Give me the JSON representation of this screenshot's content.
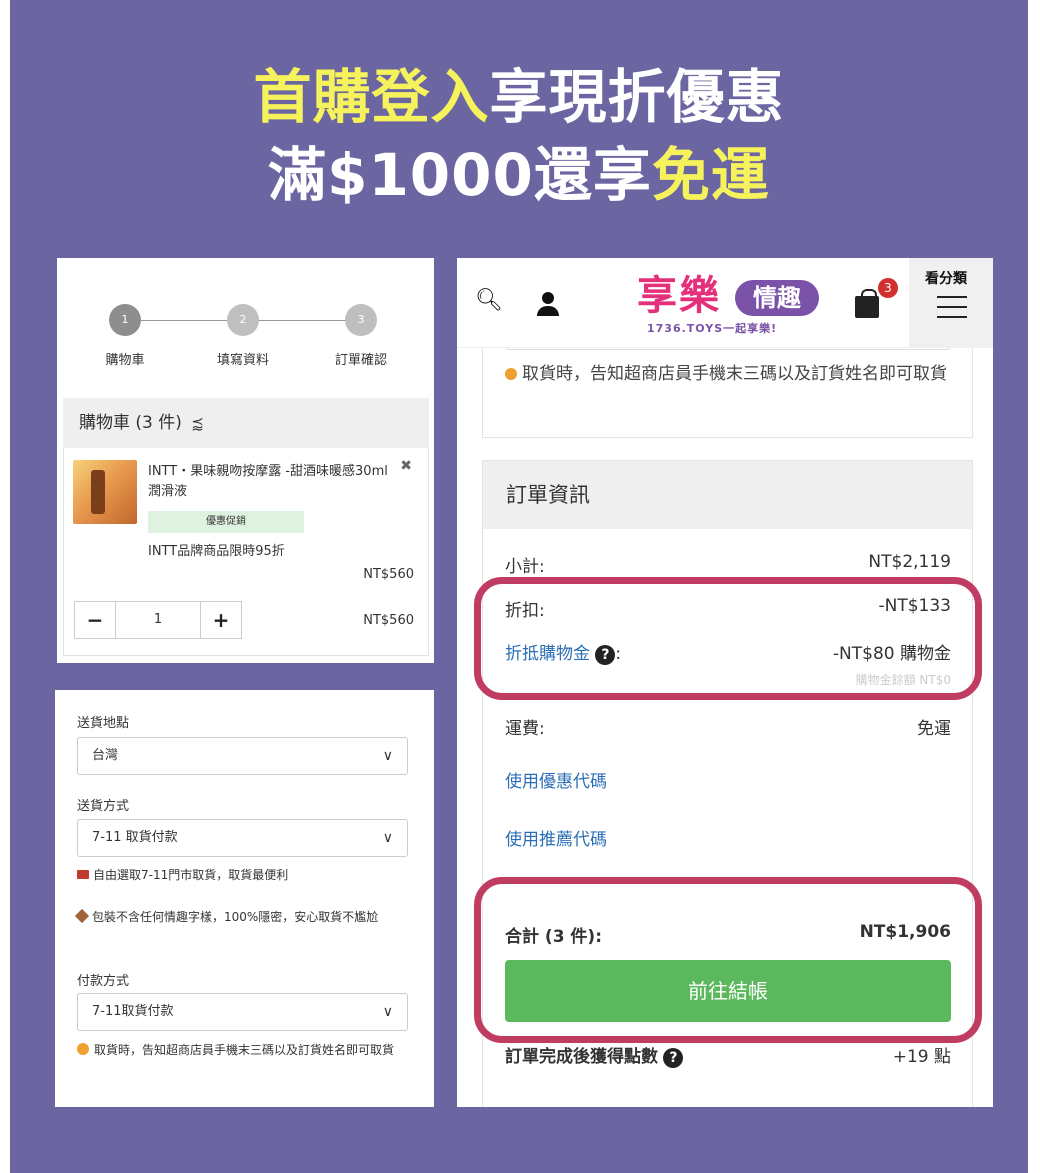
{
  "banner": {
    "line1_highlight": "首購登入",
    "line1_rest": "享現折優惠",
    "line2_rest": "滿$1000還享",
    "line2_highlight": "免運"
  },
  "cart": {
    "steps": [
      {
        "num": "1",
        "label": "購物車"
      },
      {
        "num": "2",
        "label": "填寫資料"
      },
      {
        "num": "3",
        "label": "訂單確認"
      }
    ],
    "header": "購物車 (3 件)",
    "item": {
      "title": "INTT・果味親吻按摩露 -甜酒味暖感30ml 潤滑液",
      "promo_tag": "優惠促銷",
      "promo_text": "INTT品牌商品限時95折",
      "price": "NT$560",
      "qty": "1",
      "line_total": "NT$560"
    }
  },
  "shipping": {
    "dest_label": "送貨地點",
    "dest_value": "台灣",
    "method_label": "送貨方式",
    "method_value": "7-11 取貨付款",
    "method_note": "自由選取7-11門市取貨，取貨最便利",
    "privacy_note": "包裝不含任何情趣字樣，100%隱密，安心取貨不尷尬",
    "payment_label": "付款方式",
    "payment_value": "7-11取貨付款",
    "payment_note": "取貨時，告知超商店員手機末三碼以及訂貨姓名即可取貨"
  },
  "order": {
    "topbar": {
      "logo_main": "享樂",
      "logo_badge": "情趣",
      "logo_sub": "1736.TOYS一起享樂!",
      "cart_count": "3",
      "menu_label": "看分類"
    },
    "prev_note": "取貨時，告知超商店員手機末三碼以及訂貨姓名即可取貨",
    "title": "訂單資訊",
    "subtotal_label": "小計:",
    "subtotal_value": "NT$2,119",
    "discount_label": "折扣:",
    "discount_value": "-NT$133",
    "credit_label": "折抵購物金",
    "credit_colon": ":",
    "credit_value": "-NT$80 購物金",
    "credit_remaining": "購物金餘額 NT$0",
    "shipping_label": "運費:",
    "shipping_value": "免運",
    "coupon_link": "使用優惠代碼",
    "referral_link": "使用推薦代碼",
    "total_label": "合計 (3 件):",
    "total_value": "NT$1,906",
    "checkout_label": "前往結帳",
    "points_label": "訂單完成後獲得點數",
    "points_value": "+19 點"
  },
  "colors": {
    "background": "#6b66a1",
    "highlight_yellow": "#f6f25c",
    "annotation_ring": "#c13c62",
    "checkout_green": "#5cb85c",
    "link_blue": "#2c6fb6",
    "brand_pink": "#e4307a",
    "brand_purple": "#7a52a8"
  }
}
